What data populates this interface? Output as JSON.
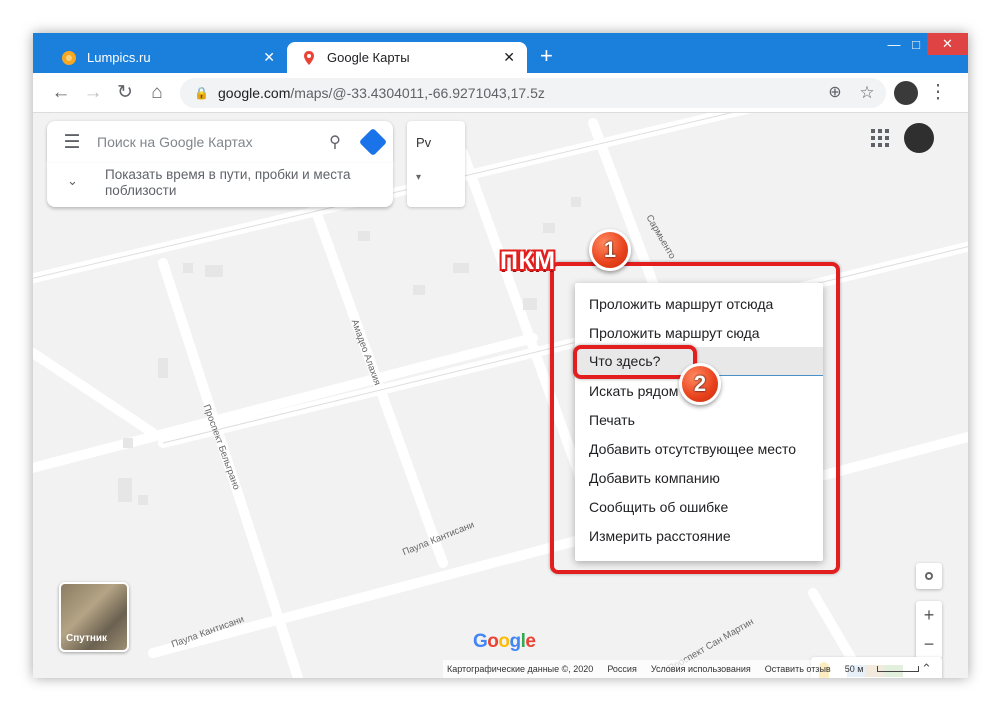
{
  "browser": {
    "tabs": [
      {
        "title": "Lumpics.ru",
        "active": false,
        "favicon": "orange-circle-icon"
      },
      {
        "title": "Google Карты",
        "active": true,
        "favicon": "google-maps-pin-icon"
      }
    ],
    "new_tab": "+",
    "window_controls": {
      "minimize": "—",
      "maximize": "□",
      "close": "✕"
    },
    "url_host": "google.com",
    "url_path": "/maps/@-33.4304011,-66.9271043,17.5z"
  },
  "maps": {
    "search_placeholder": "Поиск на Google Картах",
    "hint_line1": "Показать время в пути, пробки и места",
    "hint_line2": "поблизости",
    "layer_label": "Pv",
    "streets": [
      "Сармьенто",
      "Амадео Алахия",
      "Проспект Бельграно",
      "Паула Кантисани",
      "Паула Кантисани",
      "Проспект Сан Мартин"
    ],
    "context_menu": [
      "Проложить маршрут отсюда",
      "Проложить маршрут сюда",
      "Что здесь?",
      "Искать рядом",
      "Печать",
      "Добавить отсутствующее место",
      "Добавить компанию",
      "Сообщить об ошибке",
      "Измерить расстояние"
    ],
    "satellite_label": "Спутник",
    "google_logo": "Google",
    "attribution": {
      "map_data": "Картографические данные ©, 2020",
      "country": "Россия",
      "terms": "Условия использования",
      "feedback": "Оставить отзыв",
      "scale": "50 м"
    },
    "zoom_in": "+",
    "zoom_out": "−"
  },
  "annotations": {
    "label_pkm": "ПКМ",
    "badge1": "1",
    "badge2": "2",
    "color_red": "#e31e1e"
  }
}
